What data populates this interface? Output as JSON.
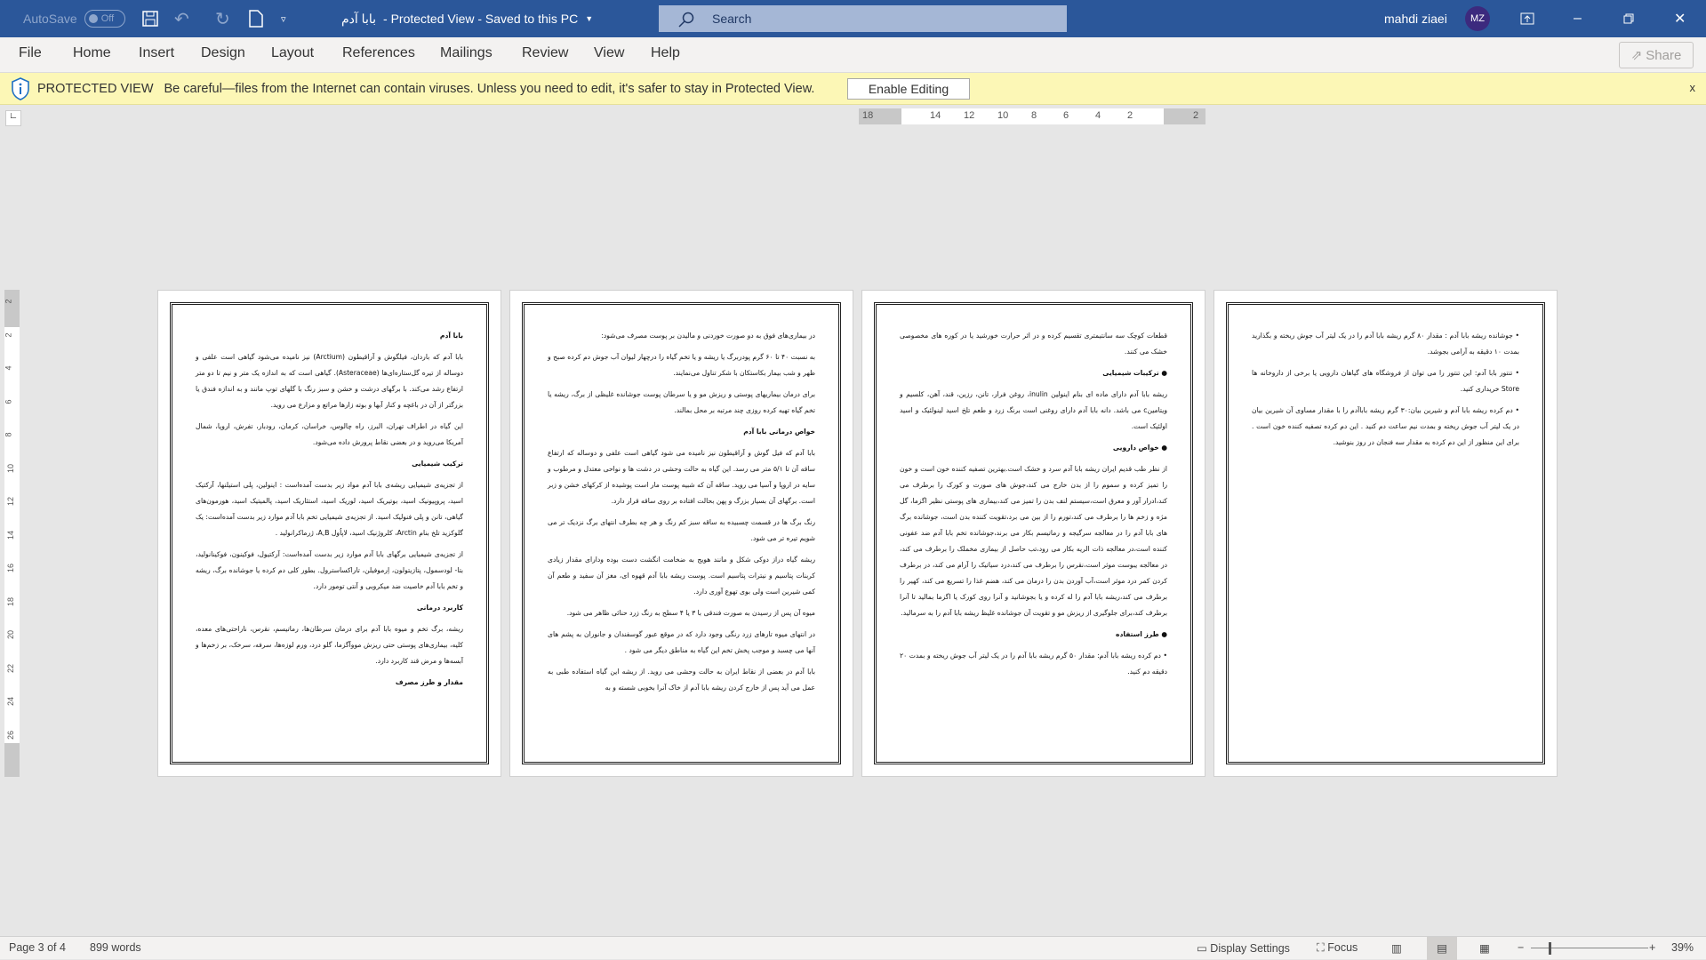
{
  "titlebar": {
    "autosave": "AutoSave",
    "autosave_state": "Off",
    "doc_name": "بابا آدم",
    "title_rest": "-  Protected View  -  Saved to this PC",
    "search_placeholder": "Search",
    "user_name": "mahdi ziaei",
    "user_initials": "MZ",
    "accent": "#2b579a"
  },
  "ribbon": {
    "tabs": [
      "File",
      "Home",
      "Insert",
      "Design",
      "Layout",
      "References",
      "Mailings",
      "Review",
      "View",
      "Help"
    ],
    "share": "Share"
  },
  "protected_view": {
    "label": "PROTECTED VIEW",
    "message": "Be careful—files from the Internet can contain viruses. Unless you need to edit, it's safer to stay in Protected View.",
    "enable_button": "Enable Editing",
    "close": "x"
  },
  "ruler": {
    "h_ticks": [
      "18",
      "14",
      "12",
      "10",
      "8",
      "6",
      "4",
      "2",
      "2"
    ],
    "v_ticks": [
      "2",
      "2",
      "4",
      "6",
      "8",
      "10",
      "12",
      "14",
      "16",
      "18",
      "20",
      "22",
      "24",
      "26"
    ]
  },
  "pages": [
    {
      "blocks": [
        {
          "h": "بابا آدم"
        },
        {
          "p": "بابا آدم که باردان، فیلگوش و آراقیطون (Arctium) نیز نامیده می‌شود گیاهی است علفی و دوساله از تیره گل‌ستاره‌ای‌ها (Asteraceae). گیاهی است که به اندازه یک متر و نیم تا دو متر ارتفاع رشد می‌کند. با برگهای درشت و خشن و سبز رنگ با گلهای توپ مانند و به اندازه فندق یا بزرگتر از آن در باغچه و کنار آبها و بوته زارها مراتع و مزارع می روید."
        },
        {
          "p": "این گیاه در اطراف تهران، البرز، راه چالوس، خراسان، کرمان، رودبار، تفرش، اروپا، شمال آمریکا می‌روید و در بعضی نقاط پرورش داده می‌شود."
        },
        {
          "h": "ترکیب شیمیایی"
        },
        {
          "p": "از تجزیه‌ی شیمیایی ریشه‌ی بابا آدم مواد زیر بدست آمده‌است : اینولین، پلی استیلنها، آرکتیک اسید، پروپیونیک اسید، بوتیریک اسید، لوریک اسید، استئاریک اسید، پالمیتیک اسید، هورمون‌های گیاهی، تانن و پلی فنولیک اسید. از تجزیه‌ی شیمیایی تخم بابا آدم موارد زیر بدست آمده‌است: یک گلوکزید تلخ بنام Arctin، کلروژنیک اسید، لاپاُول A,B، ژرماکرانولید ."
        },
        {
          "p": "از تجزیه‌ی شیمیایی برگهای بابا آدم موارد زیر بدست آمده‌است: آرکتیول، فوکینون، فوکینانولید، بتا- لودسمول، پتازیتولون، اِرموفیلن، تاراکساسترول. بطور کلی دم کرده یا جوشانده برگ، ریشه و تخم بابا آدم خاصیت ضد میکروبی و آنتی تومور دارد."
        },
        {
          "h": "کاربرد درمانی"
        },
        {
          "p": "ریشه، برگ تخم و میوه بابا آدم برای درمان سرطان‌ها، رماتیسم، نقرس، ناراحتی‌های معده، کلیه، بیماری‌های پوستی حتی ریزش مووآگزما، گلو درد، ورم لوزه‌ها، سرفه، سرخک، بر زخم‌ها و آبسه‌ها و مرض قند کاربرد دارد."
        },
        {
          "h": "مقدار و طرز مصرف"
        }
      ]
    },
    {
      "blocks": [
        {
          "p": "در بیماری‌های فوق به دو صورت خوردنی و مالیدن بر پوست مصرف می‌شود:"
        },
        {
          "p": "به نسبت ۴۰ تا ۶۰ گرم پودربرگ یا ریشه و یا تخم گیاه را درچهار لیوان آب جوش دم کرده صبح و ظهر و شب بیمار بکاستکان با شکر تناول می‌نمایند."
        },
        {
          "p": "برای درمان بیماریهای پوستی و ریزش مو و یا سرطان پوست جوشانده غلیظی از برگ، ریشه یا تخم گیاه تهیه کرده روزی چند مرتبه بر محل بمالند."
        },
        {
          "h": "خواص درمانی بابا آدم"
        },
        {
          "p": "بابا آدم که فیل گوش و آراقیطون نیز نامیده می شود گیاهی است علفی و دوساله که ارتفاع ساقه آن تا ۵/۱ متر می رسد. این گیاه به حالت وحشی در دشت ها و نواحی معتدل و مرطوب و سایه در اروپا و آسیا می روید. ساقه آن که شبیه پوست مار است پوشیده از کرکهای خشن و زبر است. برگهای آن بسیار بزرگ و پهن بحالت افتاده بر روی ساقه قرار دارد."
        },
        {
          "p": "رنگ برگ ها در قسمت چسبیده به ساقه سبز کم رنگ و هر چه بطرف انتهای برگ نزدیک تر می شویم تیره تر می شود."
        },
        {
          "p": "ریشه گیاه دراز دوکی شکل و مانند هویج به ضخامت انگشت دست بوده ودارای مقدار زیادی کربنات پتاسیم و نیترات پتاسیم است. پوست ریشه بابا آدم قهوه ای، مغز آن سفید و طعم آن کمی شیرین است ولی بوی تهوع آوری دارد."
        },
        {
          "p": "میوه آن پس از رسیدن به صورت فندقی با ۳ یا ۴ سطح به رنگ زرد حنائی ظاهر می شود."
        },
        {
          "p": "در انتهای میوه تارهای زرد رنگی وجود دارد که در موقع عبور گوسفندان و جانوران به پشم های آنها می چسبد و موجب پخش تخم این گیاه به مناطق دیگر می شود ."
        },
        {
          "p": "بابا آدم در بعضی از نقاط ایران به حالت وحشی می روید. از ریشه این گیاه استفاده طبی به عمل می آید پس از خارج کردن ریشه بابا آدم از خاک آنرا بخوبی شسته و به"
        }
      ]
    },
    {
      "blocks": [
        {
          "p": "قطعات کوچک سه سانتیمتری تقسیم کرده و در اثر حرارت خورشید یا در کوره های مخصوصی خشک می کنند."
        },
        {
          "h": "● ترکیبات شیمیایی"
        },
        {
          "p": "ریشه بابا آدم دارای ماده ای بنام اینولین inulin، روغن فرار، تانن، رزین، قند، آهن، کلسیم و ویتامینc می باشد. دانه بابا آدم دارای روغنی است برنگ زرد و طعم تلخ اسید لینولئیک و اسید اولئیک است."
        },
        {
          "h": "● خواص دارویی"
        },
        {
          "p": "از نظر طب قدیم ایران ریشه بابا آدم سرد و خشک است.بهترین تصفیه کننده خون است و خون را تمیز کرده و سموم را از بدن خارج می کند،جوش های صورت و کورک را برطرف می کند،ادرار آور و معرق است،سیستم لنف بدن را تمیز می کند،بیماری های پوستی نظیر اگزما، گل مژه و زخم ها را برطرف می کند،تورم را از بین می برد،تقویت کننده بدن است، جوشانده برگ های بابا آدم را در معالجه سرگیجه و رماتیسم بکار می برند،جوشانده تخم بابا آدم ضد عفونی کننده است،در معالجه ذات الریه بکار می رود،تب حاصل از بیماری مخملک را برطرف می کند، در معالجه یبوست موثر است،نقرس را برطرف می کند،درد سیاتیک را آرام می کند، در برطرف کردن کمر درد موثر است،آب آوردن بدن را درمان می کند، هضم غذا را تسریع می کند، کهیر را برطرف می کند،ریشه بابا آدم را له کرده و یا بجوشانید و آنرا روی کورک یا اگزما بمالید تا آنرا برطرف کند،برای جلوگیری از ریزش مو و تقویت آن جوشانده غلیظ ریشه بابا آدم را به سرمالید."
        },
        {
          "h": "● طرز استفاده"
        },
        {
          "p": "• دم کرده ریشه بابا آدم: مقدار ۵۰ گرم ریشه بابا آدم را در یک لیتر آب جوش ریخته و بمدت ۲۰ دقیقه دم کنید."
        }
      ]
    },
    {
      "blocks": [
        {
          "p": "• جوشانده ریشه بابا آدم : مقدار ۸۰ گرم ریشه بابا آدم را در یک لیتر آب جوش ریخته و بگذارید بمدت ۱۰ دقیقه به آرامی بجوشد."
        },
        {
          "p": "• تنتور بابا آدم: این تنتور را می توان از فروشگاه های گیاهان دارویی یا برخی از داروخانه ها Store خریداری کنید."
        },
        {
          "p": "• دم کرده ریشه بابا آدم و شیرین بیان:۳۰ گرم ریشه باباآدم را با مقدار مساوی آن شیرین بیان در یک لیتر آب جوش ریخته و بمدت نیم ساعت دم کنید . این دم کرده تصفیه کننده خون است . برای این منظور از این دم کرده به مقدار سه فنجان در روز بنوشید."
        }
      ]
    }
  ],
  "status": {
    "page": "Page 3 of 4",
    "words": "899 words",
    "display_settings": "Display Settings",
    "focus": "Focus",
    "zoom": "39%"
  }
}
